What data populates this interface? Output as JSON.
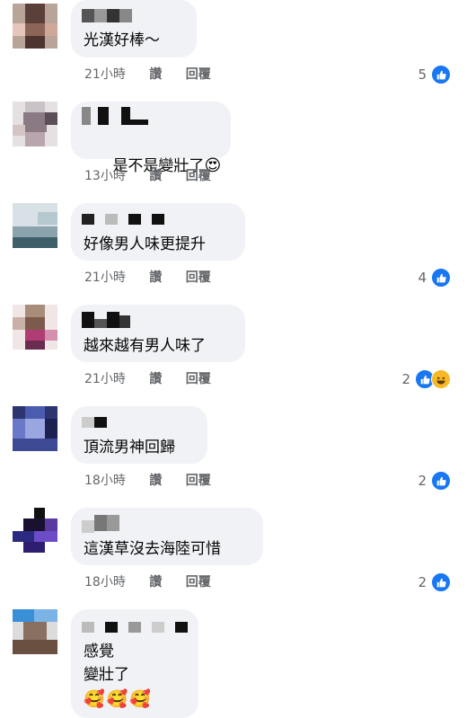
{
  "comments": [
    {
      "text": "光漢好棒～",
      "time": "21小時",
      "like_action": "讚",
      "reply_action": "回覆",
      "reaction_count": "5",
      "reactions": [
        "like-icon"
      ]
    },
    {
      "text": "是不是變壯了",
      "emoji": "😍",
      "time": "13小時",
      "like_action": "讚",
      "reply_action": "回覆",
      "reaction_count": "",
      "reactions": []
    },
    {
      "text": "好像男人味更提升",
      "time": "21小時",
      "like_action": "讚",
      "reply_action": "回覆",
      "reaction_count": "4",
      "reactions": [
        "like-icon"
      ]
    },
    {
      "text": "越來越有男人味了",
      "time": "21小時",
      "like_action": "讚",
      "reply_action": "回覆",
      "reaction_count": "2",
      "reactions": [
        "like-icon",
        "haha-icon"
      ]
    },
    {
      "text": "頂流男神回歸",
      "time": "18小時",
      "like_action": "讚",
      "reply_action": "回覆",
      "reaction_count": "2",
      "reactions": [
        "like-icon"
      ]
    },
    {
      "text": "這漢草沒去海陸可惜",
      "time": "18小時",
      "like_action": "讚",
      "reply_action": "回覆",
      "reaction_count": "2",
      "reactions": [
        "like-icon"
      ]
    },
    {
      "text_line1": "感覺",
      "text_line2": "變壯了",
      "emojis": "🥰🥰🥰",
      "reactions": []
    }
  ],
  "colors": {
    "bubble": "#f0f2f5",
    "text": "#050505",
    "meta": "#65676b",
    "like_blue": "#1877f2"
  }
}
